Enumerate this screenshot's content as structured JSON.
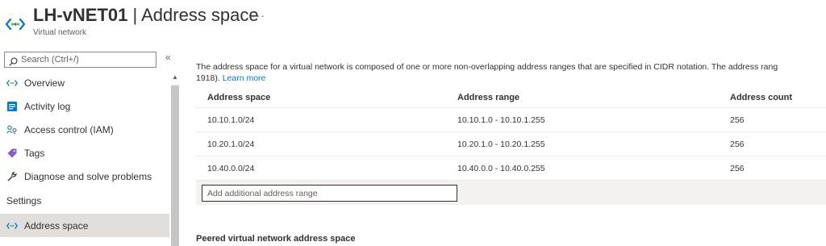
{
  "header": {
    "resource_name": "LH-vNET01",
    "separator": "|",
    "section_title": "Address space",
    "more_label": "···",
    "subtitle": "Virtual network"
  },
  "sidebar": {
    "search_placeholder": "Search (Ctrl+/)",
    "collapse_label": "«",
    "scroll_up_label": "▲",
    "items": [
      {
        "label": "Overview",
        "icon": "vnet-icon"
      },
      {
        "label": "Activity log",
        "icon": "activity-log-icon"
      },
      {
        "label": "Access control (IAM)",
        "icon": "iam-icon"
      },
      {
        "label": "Tags",
        "icon": "tag-icon"
      },
      {
        "label": "Diagnose and solve problems",
        "icon": "wrench-icon"
      }
    ],
    "section_settings": "Settings",
    "active_item": {
      "label": "Address space",
      "icon": "vnet-icon"
    }
  },
  "main": {
    "description": "The address space for a virtual network is composed of one or more non-overlapping address ranges that are specified in CIDR notation. The address rang",
    "description_line2": "1918).",
    "learn_more": "Learn more",
    "table": {
      "headers": [
        "Address space",
        "Address range",
        "Address count"
      ],
      "rows": [
        [
          "10.10.1.0/24",
          "10.10.1.0 - 10.10.1.255",
          "256"
        ],
        [
          "10.20.1.0/24",
          "10.20.1.0 - 10.20.1.255",
          "256"
        ],
        [
          "10.40.0.0/24",
          "10.40.0.0 - 10.40.0.255",
          "256"
        ]
      ],
      "add_placeholder": "Add additional address range"
    },
    "peered_title": "Peered virtual network address space"
  },
  "colors": {
    "accent": "#0078d4",
    "active_item_bg": "#e1dfdd",
    "add_row_bg": "#f3f2f1"
  }
}
